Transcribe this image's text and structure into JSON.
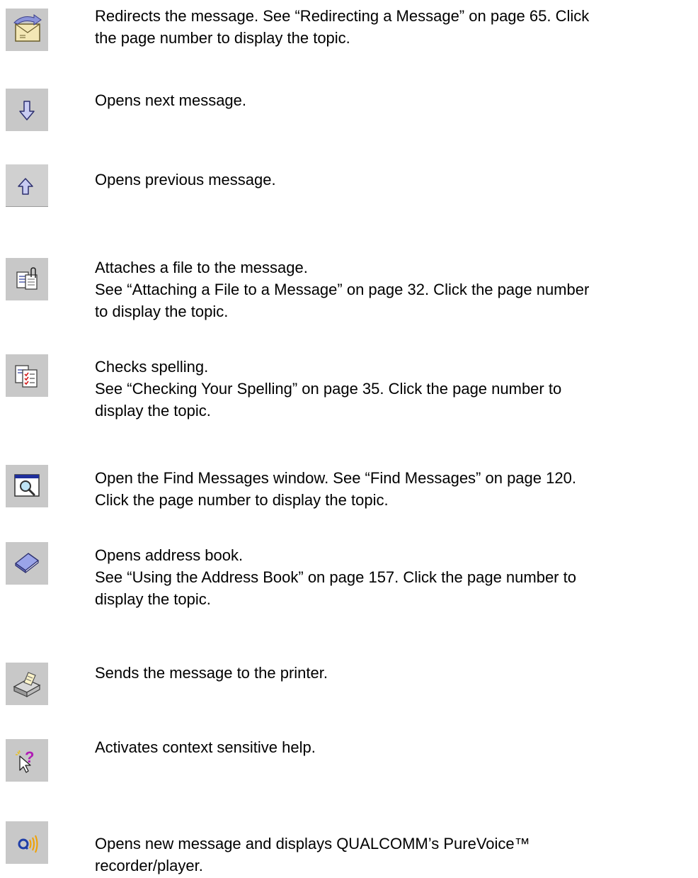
{
  "rows": [
    {
      "icon": "redirect-envelope-icon",
      "lines": [
        "Redirects the message. See “Redirecting a Message” on page 65. Click",
        "the page number to display the topic."
      ]
    },
    {
      "icon": "down-arrow-icon",
      "lines": [
        "Opens next message."
      ]
    },
    {
      "icon": "up-arrow-icon",
      "lines": [
        "Opens previous message."
      ]
    },
    {
      "icon": "attach-file-icon",
      "lines": [
        "Attaches a file to the message.",
        "See “Attaching a File to a Message” on page 32. Click the page number",
        "to display the topic."
      ]
    },
    {
      "icon": "spell-check-icon",
      "lines": [
        "Checks spelling.",
        "See “Checking Your Spelling” on page 35. Click the page number to",
        "display the topic."
      ]
    },
    {
      "icon": "find-messages-icon",
      "lines": [
        "Open the Find Messages window. See “Find Messages” on page 120.",
        "Click the page number to display the topic."
      ]
    },
    {
      "icon": "address-book-icon",
      "lines": [
        "Opens address book.",
        "See “Using the Address Book” on page 157. Click the page number to",
        "display the topic."
      ]
    },
    {
      "icon": "printer-icon",
      "lines": [
        "Sends the message to the printer."
      ]
    },
    {
      "icon": "context-help-icon",
      "lines": [
        "Activates context sensitive help."
      ]
    },
    {
      "icon": "purevoice-icon",
      "lines": [
        "Opens new message and displays QUALCOMM’s PureVoice™",
        "recorder/player."
      ]
    }
  ]
}
